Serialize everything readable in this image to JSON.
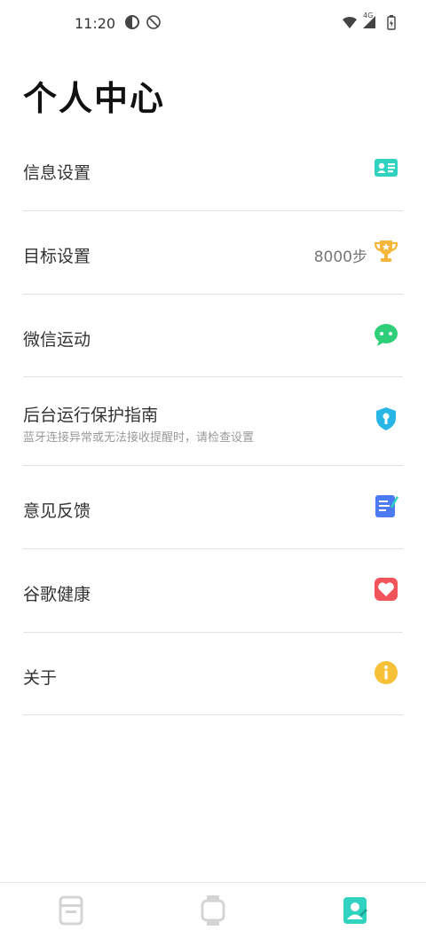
{
  "status_bar": {
    "time": "11:20",
    "network": "4G"
  },
  "title": "个人中心",
  "menu": [
    {
      "label": "信息设置",
      "icon": "profile-card-icon",
      "color": "#2fd3c0"
    },
    {
      "label": "目标设置",
      "value": "8000步",
      "icon": "trophy-icon",
      "color": "#f5b63a"
    },
    {
      "label": "微信运动",
      "icon": "wechat-icon",
      "color": "#2fcf7a"
    },
    {
      "label": "后台运行保护指南",
      "sublabel": "蓝牙连接异常或无法接收提醒时，请检查设置",
      "icon": "shield-icon",
      "color": "#28b6e6"
    },
    {
      "label": "意见反馈",
      "icon": "feedback-note-icon",
      "color": "#4c7af0"
    },
    {
      "label": "谷歌健康",
      "icon": "heart-icon",
      "color": "#f2545b"
    },
    {
      "label": "关于",
      "icon": "info-icon",
      "color": "#f6c137"
    }
  ],
  "bottom_nav": {
    "tabs": [
      "activity-tab",
      "device-tab",
      "profile-tab"
    ],
    "active_color": "#2fd3c0",
    "inactive_color": "#d4d4d4"
  }
}
